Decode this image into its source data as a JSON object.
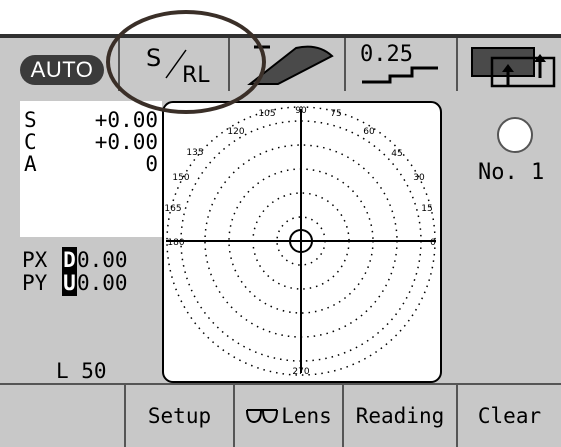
{
  "toolbar": {
    "auto_label": "AUTO",
    "mode_s": "S",
    "mode_rl": "RL",
    "step_value": "0.25"
  },
  "readout": {
    "rows": [
      {
        "label": "S",
        "value": "+0.00"
      },
      {
        "label": "C",
        "value": "+0.00"
      },
      {
        "label": "A",
        "value": "0"
      }
    ],
    "prism": [
      {
        "label": "PX",
        "dir": "D",
        "value": "0.00"
      },
      {
        "label": "PY",
        "dir": "U",
        "value": "0.00"
      }
    ],
    "l_value": "L 50"
  },
  "target": {
    "angles": [
      "90",
      "105",
      "75",
      "120",
      "60",
      "135",
      "45",
      "150",
      "30",
      "165",
      "15",
      "180",
      "0",
      "270"
    ]
  },
  "status": {
    "number_label": "No. 1"
  },
  "bottom": {
    "setup": "Setup",
    "lens": "Lens",
    "reading": "Reading",
    "clear": "Clear"
  },
  "colors": {
    "panel_bg": "#c8c8c8",
    "dark": "#3b3b3b",
    "annotation_oval": "#3a2f28"
  }
}
